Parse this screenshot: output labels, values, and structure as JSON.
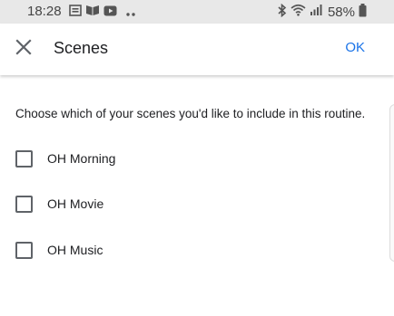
{
  "status_bar": {
    "time": "18:28",
    "battery_percent": "58%",
    "icons": [
      "gallery-icon",
      "book-icon",
      "youtube-icon",
      "more-dots-icon",
      "bluetooth-icon",
      "wifi-icon",
      "signal-icon",
      "battery-icon"
    ]
  },
  "app_bar": {
    "close_icon": "close-icon",
    "title": "Scenes",
    "ok_label": "OK"
  },
  "content": {
    "instruction": "Choose which of your scenes you'd like to include in this routine.",
    "scenes": [
      {
        "label": "OH Morning",
        "checked": false
      },
      {
        "label": "OH Movie",
        "checked": false
      },
      {
        "label": "OH Music",
        "checked": false
      }
    ]
  },
  "colors": {
    "accent": "#1a73e8",
    "text_primary": "#202124",
    "icon_gray": "#5f6368",
    "status_bar_bg": "#e8e8e8"
  }
}
